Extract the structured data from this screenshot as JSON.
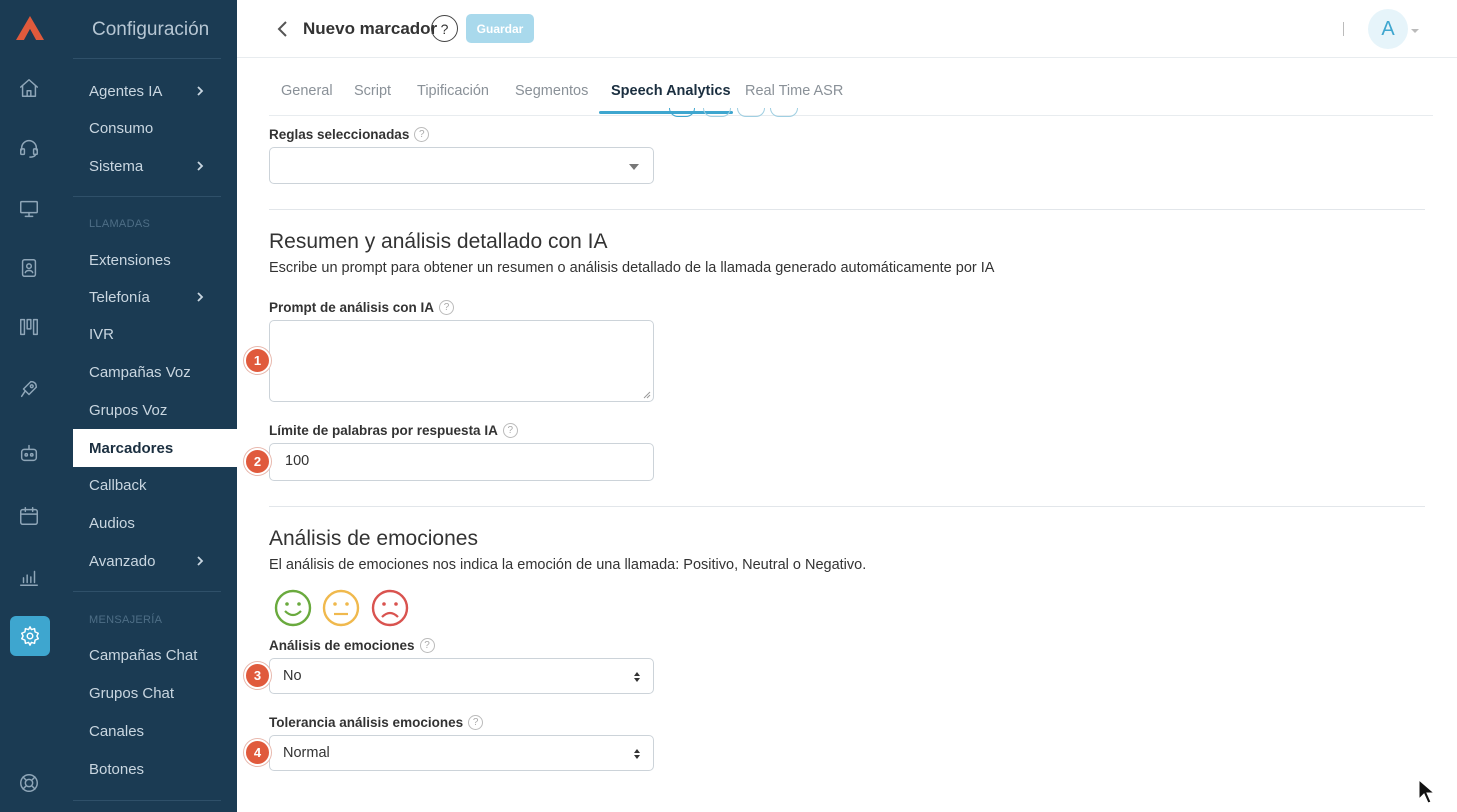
{
  "colors": {
    "sidebar_bg": "#1b3b53",
    "accent": "#3ea6cf",
    "badge": "#e05a3c",
    "positive": "#6aaa3e",
    "neutral": "#f0b94d",
    "negative": "#d9534f"
  },
  "rail": {
    "icons": [
      "logo-icon",
      "home-icon",
      "headset-icon",
      "monitor-icon",
      "contacts-icon",
      "columns-icon",
      "rocket-icon",
      "robot-icon",
      "calendar-icon",
      "stats-icon",
      "settings-icon",
      "support-icon"
    ]
  },
  "sidebar": {
    "title": "Configuración",
    "items_top": [
      {
        "label": "Agentes IA",
        "chevron": true
      },
      {
        "label": "Consumo"
      },
      {
        "label": "Sistema",
        "chevron": true
      }
    ],
    "section_calls": "LLAMADAS",
    "items_calls": [
      {
        "label": "Extensiones"
      },
      {
        "label": "Telefonía",
        "chevron": true
      },
      {
        "label": "IVR"
      },
      {
        "label": "Campañas Voz"
      },
      {
        "label": "Grupos Voz"
      },
      {
        "label": "Marcadores",
        "active": true
      },
      {
        "label": "Callback"
      },
      {
        "label": "Audios"
      },
      {
        "label": "Avanzado",
        "chevron": true
      }
    ],
    "section_messaging": "MENSAJERÍA",
    "items_messaging": [
      {
        "label": "Campañas Chat"
      },
      {
        "label": "Grupos Chat"
      },
      {
        "label": "Canales"
      },
      {
        "label": "Botones"
      }
    ]
  },
  "header": {
    "title": "Nuevo marcador",
    "help": "?",
    "save_label": "Guardar",
    "avatar_initial": "A"
  },
  "tabs": [
    {
      "label": "General"
    },
    {
      "label": "Script"
    },
    {
      "label": "Tipificación"
    },
    {
      "label": "Segmentos"
    },
    {
      "label": "Speech Analytics",
      "active": true
    },
    {
      "label": "Real Time ASR"
    }
  ],
  "form": {
    "rules_label": "Reglas seleccionadas",
    "rules_value": "",
    "summary_heading": "Resumen y análisis detallado con IA",
    "summary_desc": "Escribe un prompt para obtener un resumen o análisis detallado de la llamada generado automáticamente por IA",
    "prompt_label": "Prompt de análisis con IA",
    "prompt_value": "",
    "word_limit_label": "Límite de palabras por respuesta IA",
    "word_limit_value": "100",
    "emotions_heading": "Análisis de emociones",
    "emotions_desc": "El análisis de emociones nos indica la emoción de una llamada: Positivo, Neutral o Negativo.",
    "emotions_icons": [
      "smile-icon",
      "neutral-face-icon",
      "sad-face-icon"
    ],
    "emotions_label": "Análisis de emociones",
    "emotions_value": "No",
    "tolerance_label": "Tolerancia análisis emociones",
    "tolerance_value": "Normal",
    "help_glyph": "?",
    "badges": [
      "1",
      "2",
      "3",
      "4"
    ]
  }
}
